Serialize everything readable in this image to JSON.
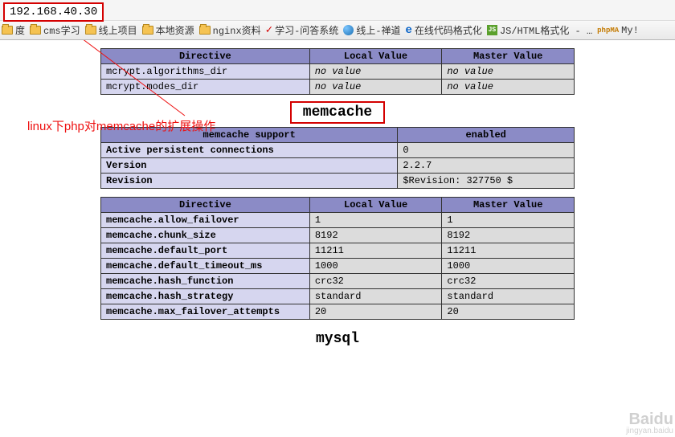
{
  "address": "192.168.40.30",
  "bookmarks": [
    {
      "type": "folder",
      "label": "度"
    },
    {
      "type": "folder",
      "label": "cms学习"
    },
    {
      "type": "folder",
      "label": "线上项目"
    },
    {
      "type": "folder",
      "label": "本地资源"
    },
    {
      "type": "folder",
      "label": "nginx资料"
    },
    {
      "type": "check",
      "label": "学习-问答系统"
    },
    {
      "type": "globe",
      "label": "线上-禅道"
    },
    {
      "type": "e",
      "label": "在线代码格式化"
    },
    {
      "type": "js",
      "label": "JS/HTML格式化 - …"
    },
    {
      "type": "pma",
      "label": "My!"
    }
  ],
  "annotation": "linux下php对memcache的扩展操作",
  "table_mcrypt": {
    "headers": [
      "Directive",
      "Local Value",
      "Master Value"
    ],
    "rows": [
      {
        "k": "mcrypt.algorithms_dir",
        "lv": "no value",
        "mv": "no value"
      },
      {
        "k": "mcrypt.modes_dir",
        "lv": "no value",
        "mv": "no value"
      }
    ]
  },
  "section_memcache": "memcache",
  "table_support": {
    "headers": [
      "memcache support",
      "enabled"
    ],
    "rows": [
      {
        "k": "Active persistent connections",
        "v": "0"
      },
      {
        "k": "Version",
        "v": "2.2.7"
      },
      {
        "k": "Revision",
        "v": "$Revision: 327750 $"
      }
    ]
  },
  "table_directives": {
    "headers": [
      "Directive",
      "Local Value",
      "Master Value"
    ],
    "rows": [
      {
        "k": "memcache.allow_failover",
        "lv": "1",
        "mv": "1"
      },
      {
        "k": "memcache.chunk_size",
        "lv": "8192",
        "mv": "8192"
      },
      {
        "k": "memcache.default_port",
        "lv": "11211",
        "mv": "11211"
      },
      {
        "k": "memcache.default_timeout_ms",
        "lv": "1000",
        "mv": "1000"
      },
      {
        "k": "memcache.hash_function",
        "lv": "crc32",
        "mv": "crc32"
      },
      {
        "k": "memcache.hash_strategy",
        "lv": "standard",
        "mv": "standard"
      },
      {
        "k": "memcache.max_failover_attempts",
        "lv": "20",
        "mv": "20"
      }
    ]
  },
  "section_mysql": "mysql",
  "watermark": {
    "big": "Baidu",
    "small": "jingyan.baidu"
  }
}
